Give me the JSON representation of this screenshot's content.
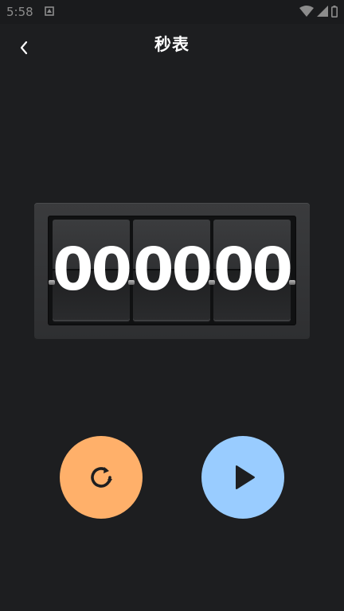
{
  "status_bar": {
    "time": "5:58",
    "icons": [
      "notification-icon",
      "wifi-icon",
      "signal-icon",
      "battery-icon"
    ]
  },
  "header": {
    "title": "秒表",
    "back_icon": "chevron-left-icon"
  },
  "stopwatch": {
    "segments": [
      "00",
      "00",
      "00"
    ]
  },
  "controls": {
    "reset": {
      "icon": "reset-icon",
      "color": "#ffb06a"
    },
    "play": {
      "icon": "play-icon",
      "color": "#99ccff"
    }
  },
  "colors": {
    "background": "#1d1e20",
    "text": "#ffffff"
  }
}
